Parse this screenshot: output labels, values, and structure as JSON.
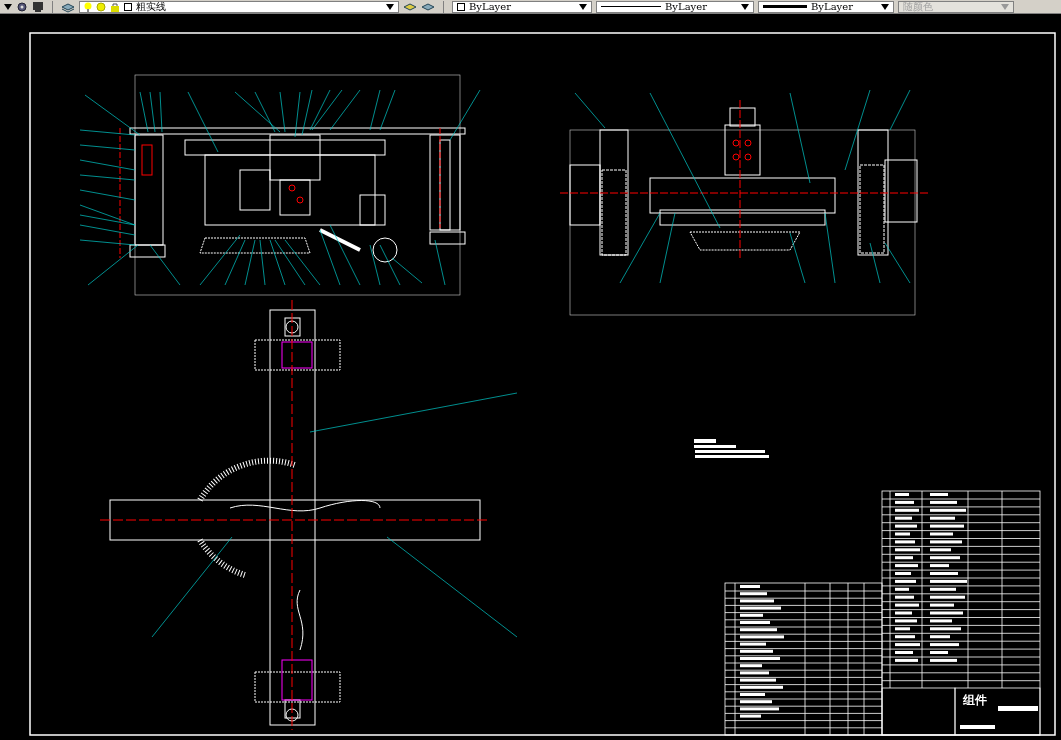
{
  "toolbar": {
    "layer": "粗实线",
    "color_setting": "ByLayer",
    "linetype": "ByLayer",
    "lineweight": "ByLayer",
    "plot_style": {
      "label": "随颜色",
      "disabled": true
    }
  },
  "title_block": {
    "title": "组件"
  }
}
